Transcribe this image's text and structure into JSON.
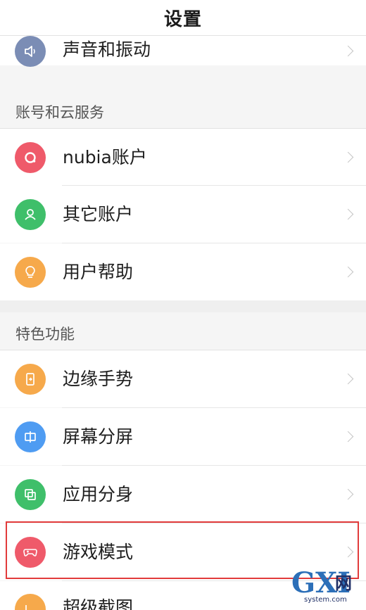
{
  "header": {
    "title": "设置"
  },
  "sections": {
    "account": "账号和云服务",
    "features": "特色功能"
  },
  "items": {
    "sound": "声音和振动",
    "nubia": "nubia账户",
    "other": "其它账户",
    "help": "用户帮助",
    "edge": "边缘手势",
    "split": "屏幕分屏",
    "clone": "应用分身",
    "game": "游戏模式",
    "screenshot": "超级截图"
  },
  "colors": {
    "sound": "#7b8db5",
    "nubia": "#ef5a6a",
    "other": "#3fbf6a",
    "help": "#f6a94b",
    "edge": "#f6a94b",
    "split": "#4f9cf2",
    "clone": "#3fbf6a",
    "game": "#ef5a6a",
    "screenshot": "#f6a94b",
    "highlight": "#e23b3b"
  },
  "icons": {
    "sound": "speaker-icon",
    "nubia": "nubia-ring-icon",
    "other": "person-icon",
    "help": "lightbulb-icon",
    "edge": "edge-gesture-icon",
    "split": "split-screen-icon",
    "clone": "app-clone-icon",
    "game": "gamepad-icon",
    "screenshot": "screenshot-icon"
  },
  "watermark": {
    "big": "GXI",
    "net": "网",
    "url": "system.com"
  }
}
